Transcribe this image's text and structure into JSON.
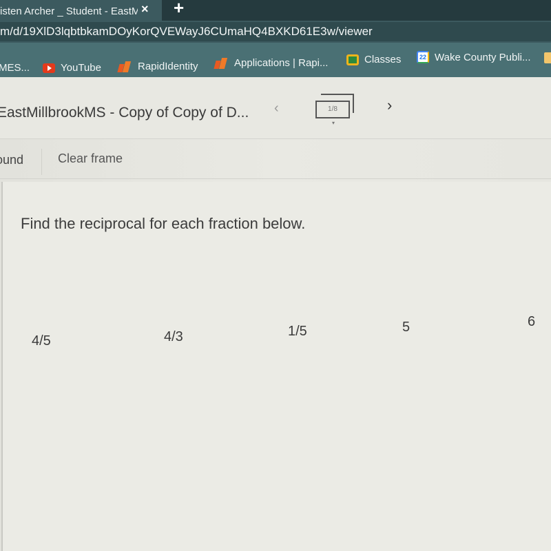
{
  "browser": {
    "tab_title": "isten Archer _ Student - EastM",
    "close_icon": "×",
    "new_tab_icon": "+",
    "url": "m/d/19XlD3lqbtbkamDOyKorQVEWayJ6CUmaHQ4BXKD61E3w/viewer",
    "bookmarks": [
      {
        "label": "MES...",
        "icon": "bookmark-icon"
      },
      {
        "label": "YouTube",
        "icon": "youtube-icon"
      },
      {
        "label": "RapidIdentity",
        "icon": "rapididentity-icon"
      },
      {
        "label": "Applications | Rapi...",
        "icon": "rapididentity-icon"
      },
      {
        "label": "Classes",
        "icon": "google-classroom-icon"
      },
      {
        "label": "Wake County Publi...",
        "icon": "calendar-icon",
        "icon_text": "22"
      }
    ]
  },
  "viewer": {
    "title": "EastMillbrookMS - Copy of Copy of D...",
    "prev_icon": "‹",
    "next_icon": "›",
    "page_counter": "1/8",
    "caret": "▾",
    "tools": {
      "background_label": "ound",
      "clear_frame_label": "Clear frame"
    }
  },
  "slide": {
    "prompt": "Find the reciprocal for each fraction below.",
    "fractions": [
      "4/5",
      "4/3",
      "1/5",
      "5",
      "6"
    ]
  }
}
